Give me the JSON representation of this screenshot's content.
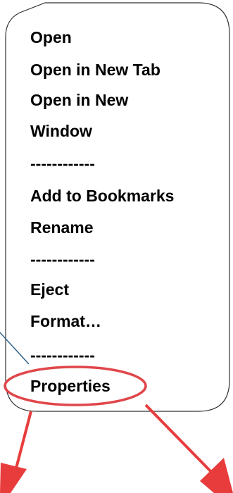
{
  "context_menu": {
    "items": [
      {
        "label": "Open"
      },
      {
        "label": "Open in New Tab"
      },
      {
        "label": "Open in New"
      },
      {
        "label": "Window"
      },
      {
        "label": "------------"
      },
      {
        "label": "Add to Bookmarks"
      },
      {
        "label": "Rename"
      },
      {
        "label": "------------"
      },
      {
        "label": "Eject"
      },
      {
        "label": "Format…"
      },
      {
        "label": "------------"
      },
      {
        "label": "Properties"
      }
    ]
  },
  "colors": {
    "highlight_ellipse": "#e0464a",
    "arrows": "#e83c3c",
    "pointer_line": "#2f5f8a",
    "menu_border": "#333333"
  }
}
